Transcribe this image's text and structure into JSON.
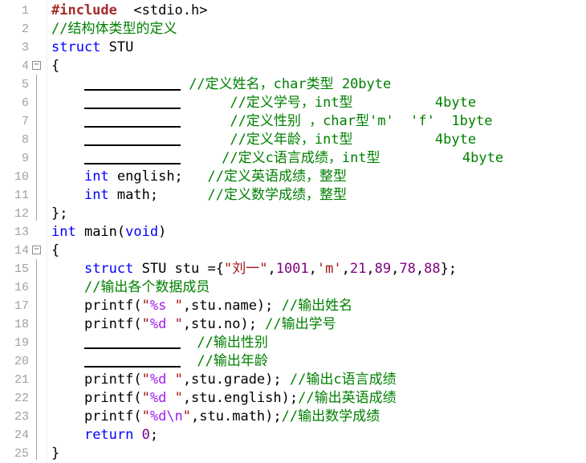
{
  "lines": [
    {
      "n": "1",
      "parts": [
        [
          "pp",
          "#include"
        ],
        [
          "",
          "  <stdio.h>"
        ]
      ]
    },
    {
      "n": "2",
      "parts": [
        [
          "cm",
          "//结构体类型的定义"
        ]
      ]
    },
    {
      "n": "3",
      "parts": [
        [
          "kw",
          "struct"
        ],
        [
          "",
          " STU"
        ]
      ]
    },
    {
      "n": "4",
      "parts": [
        [
          "",
          "{"
        ]
      ],
      "fold": "−"
    },
    {
      "n": "5",
      "parts": [
        [
          "",
          "    "
        ],
        [
          "blank",
          ""
        ],
        [
          "cm",
          " //定义姓名，char类型 20byte"
        ]
      ]
    },
    {
      "n": "6",
      "parts": [
        [
          "",
          "    "
        ],
        [
          "blank",
          ""
        ],
        [
          "cm",
          "      //定义学号，int型          4byte"
        ]
      ]
    },
    {
      "n": "7",
      "parts": [
        [
          "",
          "    "
        ],
        [
          "blank",
          ""
        ],
        [
          "cm",
          "      //定义性别 ，char型'm'  'f'  1byte"
        ]
      ]
    },
    {
      "n": "8",
      "parts": [
        [
          "",
          "    "
        ],
        [
          "blank",
          ""
        ],
        [
          "cm",
          "      //定义年龄，int型          4byte"
        ]
      ]
    },
    {
      "n": "9",
      "parts": [
        [
          "",
          "    "
        ],
        [
          "blank",
          ""
        ],
        [
          "cm",
          "     //定义c语言成绩，int型          4byte"
        ]
      ]
    },
    {
      "n": "10",
      "parts": [
        [
          "",
          "    "
        ],
        [
          "kw",
          "int"
        ],
        [
          "",
          " english;   "
        ],
        [
          "cm",
          "//定义英语成绩，整型"
        ]
      ]
    },
    {
      "n": "11",
      "parts": [
        [
          "",
          "    "
        ],
        [
          "kw",
          "int"
        ],
        [
          "",
          " math;      "
        ],
        [
          "cm",
          "//定义数学成绩，整型"
        ]
      ]
    },
    {
      "n": "12",
      "parts": [
        [
          "",
          "};"
        ]
      ]
    },
    {
      "n": "13",
      "parts": [
        [
          "kw",
          "int"
        ],
        [
          "",
          " main("
        ],
        [
          "kw",
          "void"
        ],
        [
          "",
          ")"
        ]
      ]
    },
    {
      "n": "14",
      "parts": [
        [
          "",
          "{"
        ]
      ],
      "fold": "−"
    },
    {
      "n": "15",
      "parts": [
        [
          "",
          "    "
        ],
        [
          "kw",
          "struct"
        ],
        [
          "",
          " STU stu ={"
        ],
        [
          "st",
          "\"刘一\""
        ],
        [
          "",
          ","
        ],
        [
          "nm",
          "1001"
        ],
        [
          "",
          ","
        ],
        [
          "st",
          "'m'"
        ],
        [
          "",
          ","
        ],
        [
          "nm",
          "21"
        ],
        [
          "",
          ","
        ],
        [
          "nm",
          "89"
        ],
        [
          "",
          ","
        ],
        [
          "nm",
          "78"
        ],
        [
          "",
          ","
        ],
        [
          "nm",
          "88"
        ],
        [
          "",
          "};"
        ]
      ]
    },
    {
      "n": "16",
      "parts": [
        [
          "",
          "    "
        ],
        [
          "cm",
          "//输出各个数据成员"
        ]
      ]
    },
    {
      "n": "17",
      "parts": [
        [
          "",
          "    printf("
        ],
        [
          "st",
          "\""
        ],
        [
          "fmt",
          "%s"
        ],
        [
          "st",
          " \""
        ],
        [
          "",
          ",stu.name); "
        ],
        [
          "cm",
          "//输出姓名"
        ]
      ]
    },
    {
      "n": "18",
      "parts": [
        [
          "",
          "    printf("
        ],
        [
          "st",
          "\""
        ],
        [
          "fmt",
          "%d"
        ],
        [
          "st",
          " \""
        ],
        [
          "",
          ",stu.no); "
        ],
        [
          "cm",
          "//输出学号"
        ]
      ]
    },
    {
      "n": "19",
      "parts": [
        [
          "",
          "    "
        ],
        [
          "blank",
          ""
        ],
        [
          "cm",
          "  //输出性别"
        ]
      ]
    },
    {
      "n": "20",
      "parts": [
        [
          "",
          "    "
        ],
        [
          "blank",
          ""
        ],
        [
          "cm",
          "  //输出年龄"
        ]
      ]
    },
    {
      "n": "21",
      "parts": [
        [
          "",
          "    printf("
        ],
        [
          "st",
          "\""
        ],
        [
          "fmt",
          "%d"
        ],
        [
          "st",
          " \""
        ],
        [
          "",
          ",stu.grade); "
        ],
        [
          "cm",
          "//输出c语言成绩"
        ]
      ]
    },
    {
      "n": "22",
      "parts": [
        [
          "",
          "    printf("
        ],
        [
          "st",
          "\""
        ],
        [
          "fmt",
          "%d"
        ],
        [
          "st",
          " \""
        ],
        [
          "",
          ",stu.english);"
        ],
        [
          "cm",
          "//输出英语成绩"
        ]
      ]
    },
    {
      "n": "23",
      "parts": [
        [
          "",
          "    printf("
        ],
        [
          "st",
          "\""
        ],
        [
          "fmt",
          "%d\\n"
        ],
        [
          "st",
          "\""
        ],
        [
          "",
          ",stu.math);"
        ],
        [
          "cm",
          "//输出数学成绩"
        ]
      ]
    },
    {
      "n": "24",
      "parts": [
        [
          "",
          "    "
        ],
        [
          "kw",
          "return"
        ],
        [
          "",
          " "
        ],
        [
          "nm",
          "0"
        ],
        [
          "",
          ";"
        ]
      ]
    },
    {
      "n": "25",
      "parts": [
        [
          "",
          "}"
        ]
      ]
    }
  ]
}
